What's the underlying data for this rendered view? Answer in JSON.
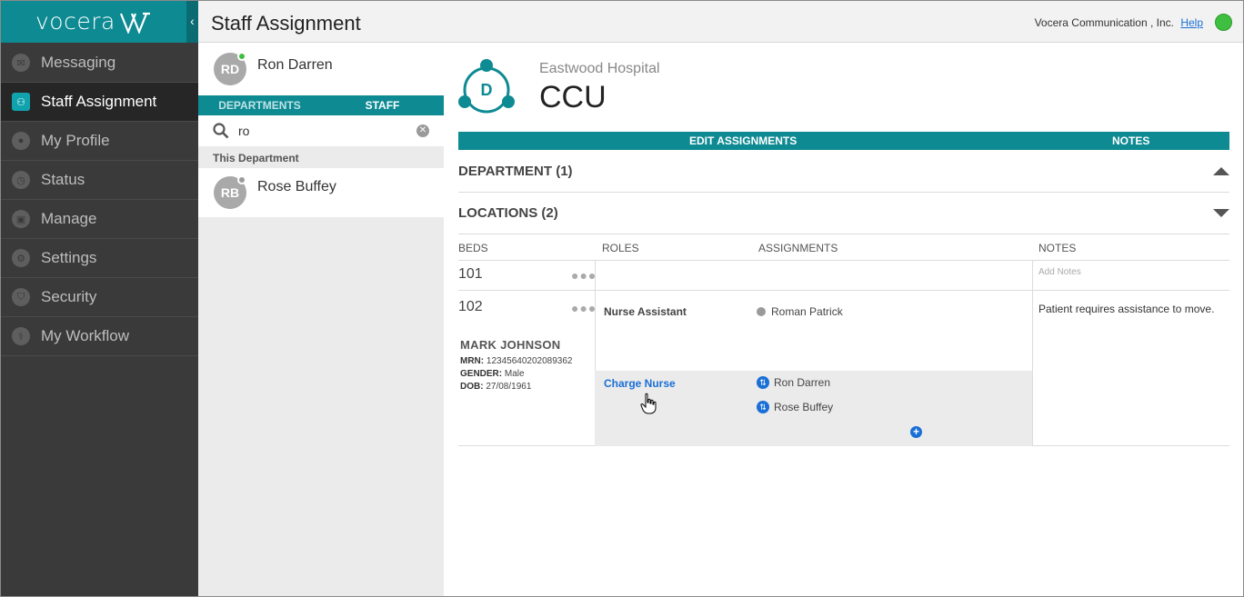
{
  "app": {
    "logo_text": "vocera",
    "page_title": "Staff Assignment",
    "company": "Vocera Communication , Inc.",
    "help_label": "Help",
    "status_color": "#3fbf3f",
    "accent_color": "#0e8a93"
  },
  "sidebar": {
    "items": [
      {
        "label": "Messaging",
        "icon": "message-icon",
        "glyph": "✉"
      },
      {
        "label": "Staff Assignment",
        "icon": "staff-icon",
        "glyph": "⚇",
        "active": true
      },
      {
        "label": "My Profile",
        "icon": "profile-icon",
        "glyph": "●"
      },
      {
        "label": "Status",
        "icon": "status-icon",
        "glyph": "◷"
      },
      {
        "label": "Manage",
        "icon": "manage-icon",
        "glyph": "▣"
      },
      {
        "label": "Settings",
        "icon": "gear-icon",
        "glyph": "⚙"
      },
      {
        "label": "Security",
        "icon": "shield-icon",
        "glyph": "⛉"
      },
      {
        "label": "My Workflow",
        "icon": "workflow-icon",
        "glyph": "⚕"
      }
    ]
  },
  "me": {
    "initials": "RD",
    "name": "Ron Darren",
    "presence_color": "#3fbf3f"
  },
  "tabs": {
    "departments": "DEPARTMENTS",
    "staff": "STAFF"
  },
  "search": {
    "value": "ro",
    "clear_glyph": "✕"
  },
  "this_department": {
    "label": "This Department",
    "staff": [
      {
        "initials": "RB",
        "name": "Rose Buffey",
        "presence_color": "#9a9a9a"
      }
    ]
  },
  "unit": {
    "hospital": "Eastwood Hospital",
    "name": "CCU",
    "logo_letter": "D"
  },
  "actions": {
    "edit": "EDIT ASSIGNMENTS",
    "notes": "NOTES"
  },
  "department_section": "DEPARTMENT (1)",
  "locations_section": "LOCATIONS (2)",
  "table": {
    "headers": {
      "beds": "BEDS",
      "roles": "ROLES",
      "assignments": "ASSIGNMENTS",
      "notes": "NOTES"
    },
    "bed101": {
      "number": "101",
      "add_notes": "Add Notes"
    },
    "bed102": {
      "number": "102",
      "patient": {
        "name": "MARK JOHNSON",
        "mrn_label": "MRN:",
        "mrn": "12345640202089362",
        "gender_label": "GENDER:",
        "gender": "Male",
        "dob_label": "DOB:",
        "dob": "27/08/1961"
      },
      "roles": [
        {
          "role": "Nurse Assistant",
          "assignees": [
            "Roman Patrick"
          ]
        },
        {
          "role": "Charge Nurse",
          "assignees": [
            "Ron Darren",
            "Rose Buffey"
          ]
        }
      ],
      "note": "Patient requires assistance to move."
    },
    "more_glyph": "●●●",
    "swap_glyph": "⇅",
    "add_glyph": "+"
  }
}
